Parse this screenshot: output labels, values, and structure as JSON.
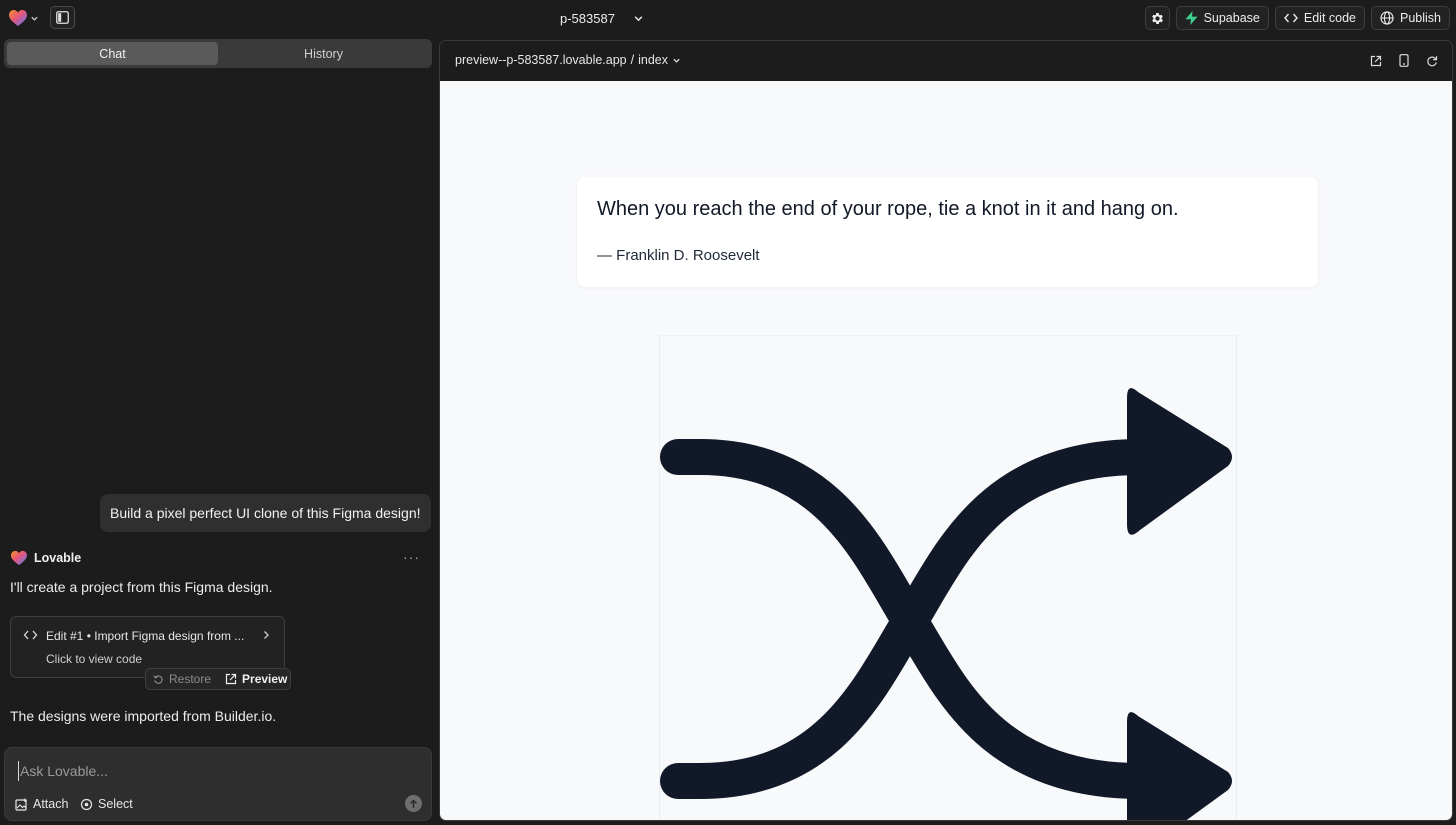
{
  "topbar": {
    "project_name": "p-583587",
    "supabase_label": "Supabase",
    "edit_code_label": "Edit code",
    "publish_label": "Publish"
  },
  "chat_panel": {
    "tabs": [
      {
        "label": "Chat",
        "active": true
      },
      {
        "label": "History",
        "active": false
      }
    ],
    "user_message": "Build a pixel perfect UI clone of this Figma design!",
    "assistant": {
      "name": "Lovable",
      "message_1": "I'll create a project from this Figma design.",
      "edit_card": {
        "title": "Edit #1 • Import Figma design from ...",
        "subtitle": "Click to view code"
      },
      "restore_label": "Restore",
      "preview_label": "Preview",
      "message_2": "The designs were imported from Builder.io."
    },
    "composer": {
      "placeholder": "Ask Lovable...",
      "attach_label": "Attach",
      "select_label": "Select"
    }
  },
  "preview": {
    "address": "preview--p-583587.lovable.app",
    "route": "index",
    "quote": {
      "text": "When you reach the end of your rope, tie a knot in it and hang on.",
      "author": "— Franklin D. Roosevelt"
    },
    "image_icon": "shuffle-icon"
  },
  "colors": {
    "app_background": "#1c1c1c",
    "supabase_green": "#3ecf8e",
    "preview_background": "#f8f9fb",
    "icon_dark": "#111827"
  }
}
